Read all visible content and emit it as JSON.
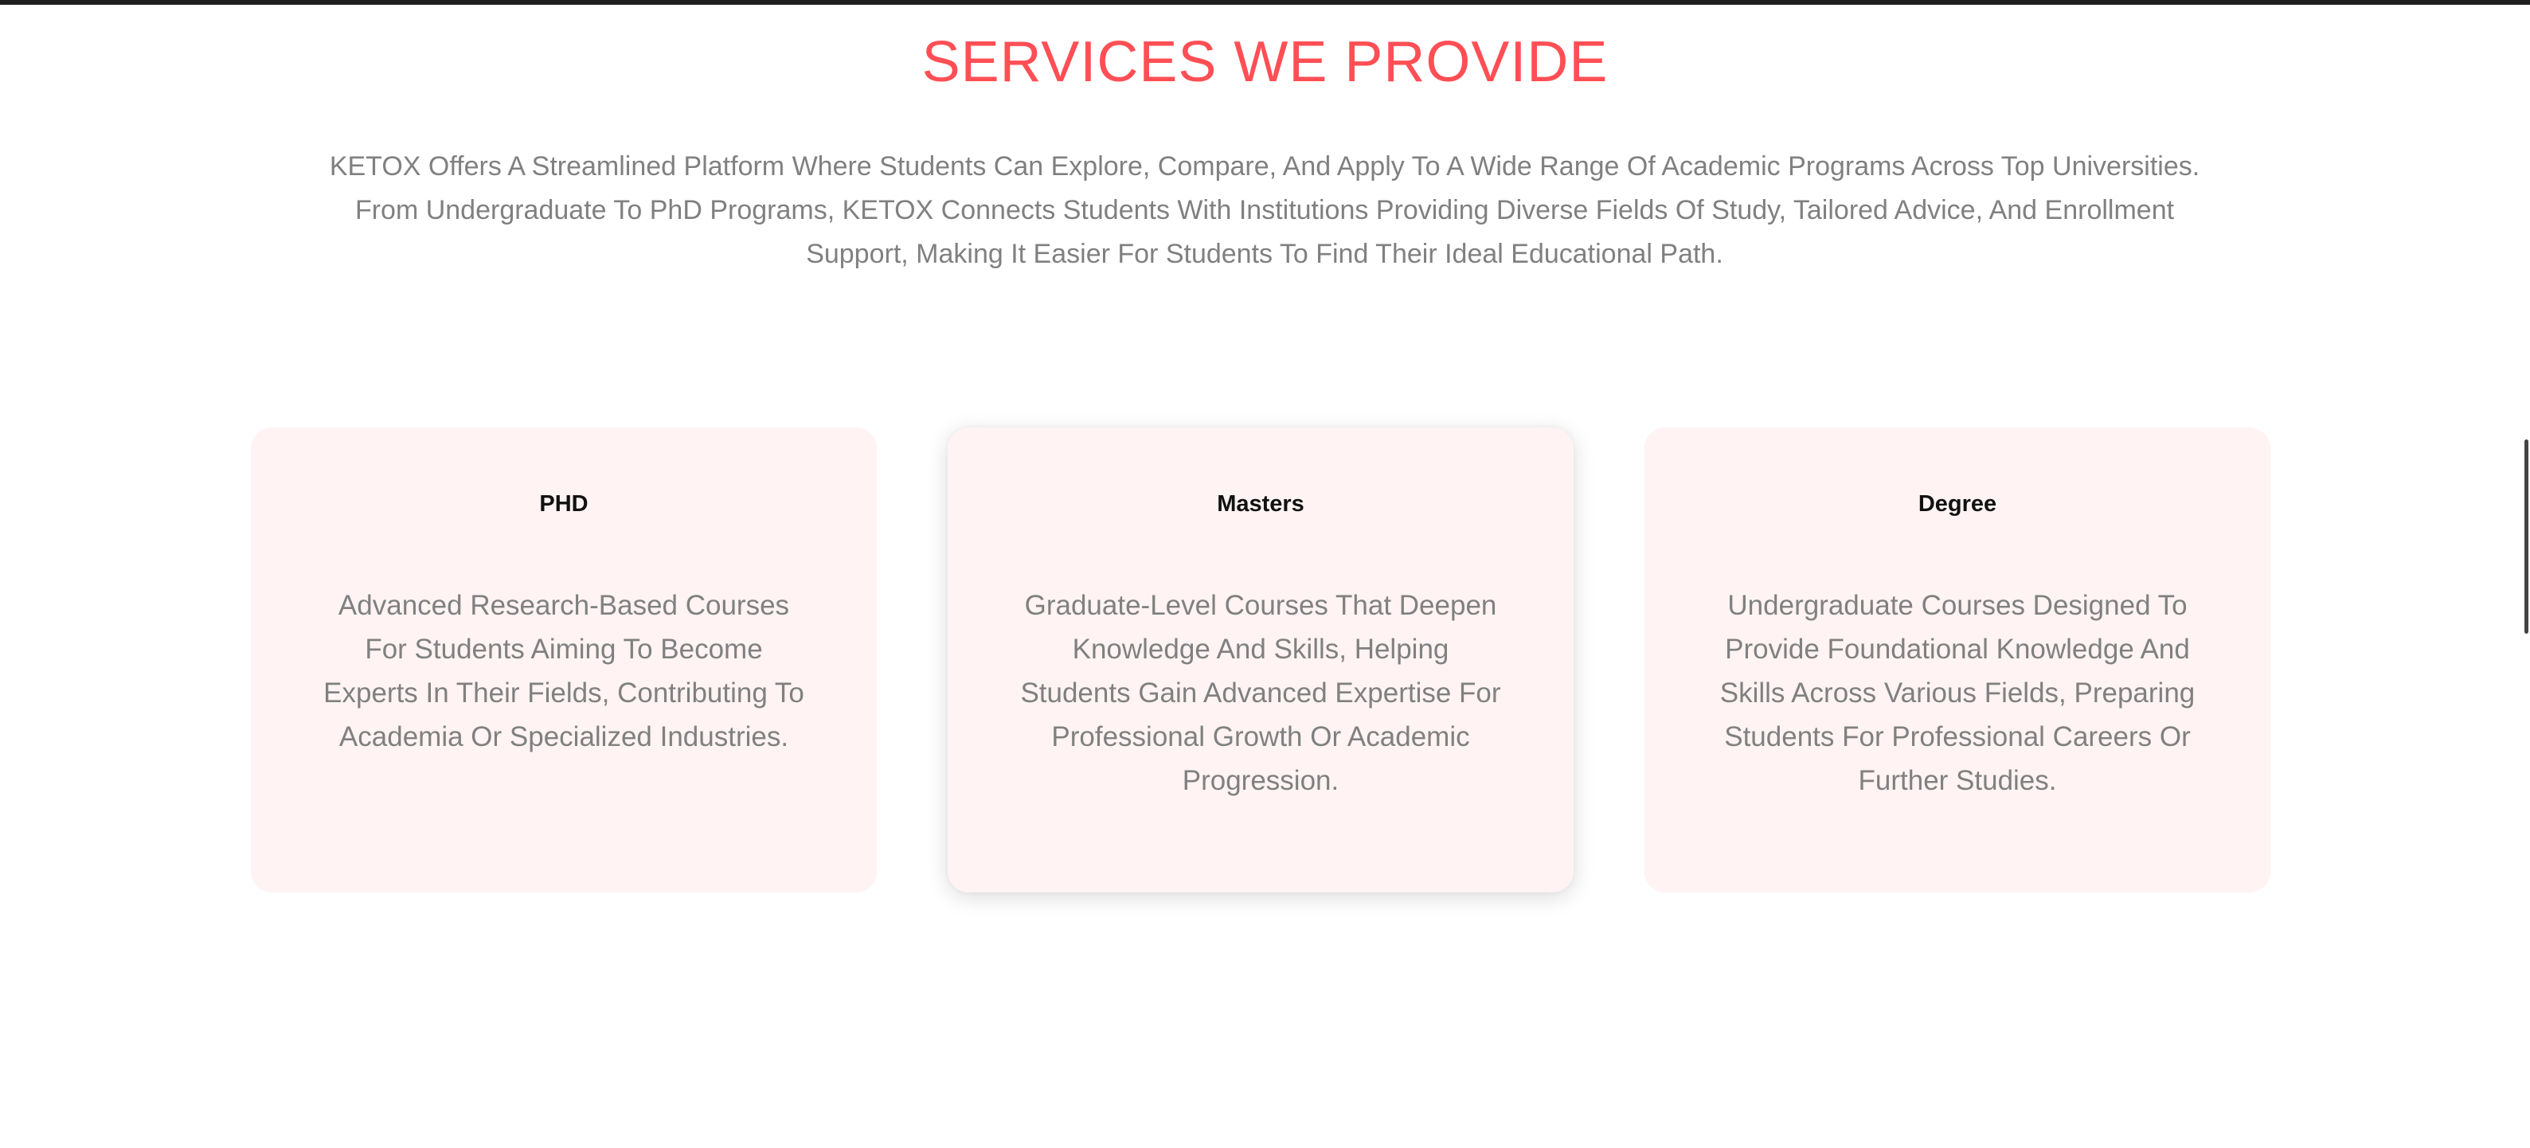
{
  "services": {
    "title": "SERVICES WE PROVIDE",
    "intro": "KETOX Offers A Streamlined Platform Where Students Can Explore, Compare, And Apply To A Wide Range Of Academic Programs Across Top Universities. From Undergraduate To PhD Programs, KETOX Connects Students With Institutions Providing Diverse Fields Of Study, Tailored Advice, And Enrollment Support, Making It Easier For Students To Find Their Ideal Educational Path.",
    "cards": [
      {
        "title": "PHD",
        "description": "Advanced Research-Based Courses For Students Aiming To Become Experts In Their Fields, Contributing To Academia Or Specialized Industries."
      },
      {
        "title": "Masters",
        "description": "Graduate-Level Courses That Deepen Knowledge And Skills, Helping Students Gain Advanced Expertise For Professional Growth Or Academic Progression."
      },
      {
        "title": "Degree",
        "description": "Undergraduate Courses Designed To Provide Foundational Knowledge And Skills Across Various Fields, Preparing Students For Professional Careers Or Further Studies."
      }
    ]
  },
  "colors": {
    "accent": "#ff4f55",
    "card_background": "#fff3f3",
    "body_text": "#808080",
    "card_title": "#111111"
  }
}
